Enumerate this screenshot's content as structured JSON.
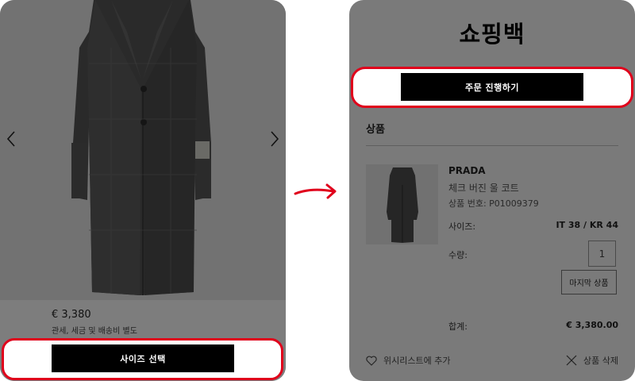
{
  "left": {
    "price": "€ 3,380",
    "price_note": "관세, 세금 및 배송비 별도",
    "size_button_label": "사이즈 선택"
  },
  "right": {
    "title": "쇼핑백",
    "checkout_button_label": "주문 진행하기",
    "section_label": "상품",
    "item": {
      "brand": "PRADA",
      "name": "체크 버진 울 코트",
      "number": "상품 번호: P01009379",
      "size_label": "사이즈:",
      "size_value": "IT 38 / KR 44",
      "qty_label": "수량:",
      "qty_value": "1",
      "last_item_tag": "마지막 상품"
    },
    "total_label": "합계:",
    "total_value": "€ 3,380.00",
    "wishlist_label": "위시리스트에 추가",
    "remove_label": "상품 삭제"
  },
  "icons": {
    "prev": "chevron-left-icon",
    "next": "chevron-right-icon",
    "wishlist": "heart-icon",
    "remove": "close-icon",
    "flow": "arrow-right-icon"
  },
  "colors": {
    "highlight": "#e0001b",
    "button": "#000000",
    "overlay": "#7a7a7a"
  }
}
